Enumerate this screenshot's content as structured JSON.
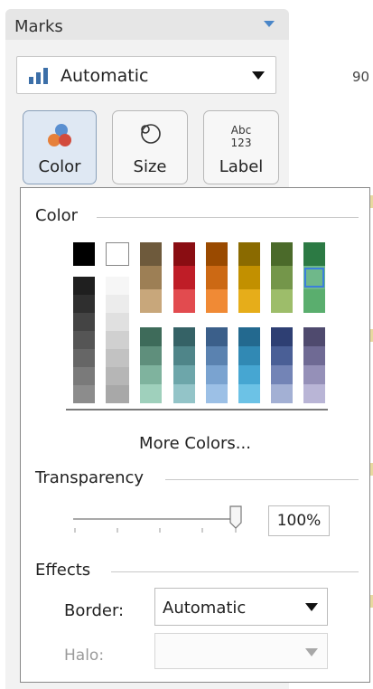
{
  "marks": {
    "title": "Marks",
    "mark_type": "Automatic",
    "buttons": [
      {
        "label": "Color",
        "icon": "color-dots-icon"
      },
      {
        "label": "Size",
        "icon": "size-circles-icon"
      },
      {
        "label": "Label",
        "icon": "abc-123-icon"
      }
    ],
    "icon_text": {
      "abc": "Abc",
      "num": "123"
    }
  },
  "sheet": {
    "axis_tick": "90"
  },
  "color_popup": {
    "section_color": "Color",
    "more_colors": "More Colors...",
    "section_transparency": "Transparency",
    "transparency_value": "100%",
    "transparency_level": 1.0,
    "section_effects": "Effects",
    "border_label": "Border:",
    "border_value": "Automatic",
    "halo_label": "Halo:",
    "halo_value": "",
    "selected_swatch": "#6fb88a",
    "palette": {
      "top_row": [
        "#000000",
        "#ffffff"
      ],
      "grays_dark": [
        "#1f1f1f",
        "#2f2f2f",
        "#444444",
        "#555555",
        "#666666",
        "#7a7a7a",
        "#8c8c8c"
      ],
      "grays_light": [
        "#f6f6f6",
        "#ececec",
        "#e0e0e0",
        "#d0d0d0",
        "#c2c2c2",
        "#b6b6b6",
        "#a8a8a8"
      ],
      "warm_columns": [
        [
          "#6e5a3c",
          "#9d7f55",
          "#c8a77b"
        ],
        [
          "#8a0d12",
          "#bf1d27",
          "#e24b4f"
        ],
        [
          "#9a4a00",
          "#cc6914",
          "#f08a35"
        ],
        [
          "#8a6a00",
          "#c29000",
          "#e6ad1a"
        ],
        [
          "#4b6a2a",
          "#74964a",
          "#9dbd6a"
        ],
        [
          "#2c7a44",
          "#6fb88a",
          "#5aae6e"
        ]
      ],
      "cool_columns": [
        [
          "#3e6b5a",
          "#5f8f7c",
          "#7fb39e",
          "#9fd0bc"
        ],
        [
          "#356266",
          "#4f8589",
          "#6da6aa",
          "#93c4c8"
        ],
        [
          "#3b5f8a",
          "#5a82b0",
          "#7aa3d0",
          "#9cc0e6"
        ],
        [
          "#23698f",
          "#3189b4",
          "#46a6d2",
          "#6cc2e6"
        ],
        [
          "#2e3f73",
          "#4a5f96",
          "#7384b6",
          "#a3b0d4"
        ],
        [
          "#4f4a6e",
          "#6f6a94",
          "#9590b8",
          "#b9b5d6"
        ]
      ]
    }
  }
}
